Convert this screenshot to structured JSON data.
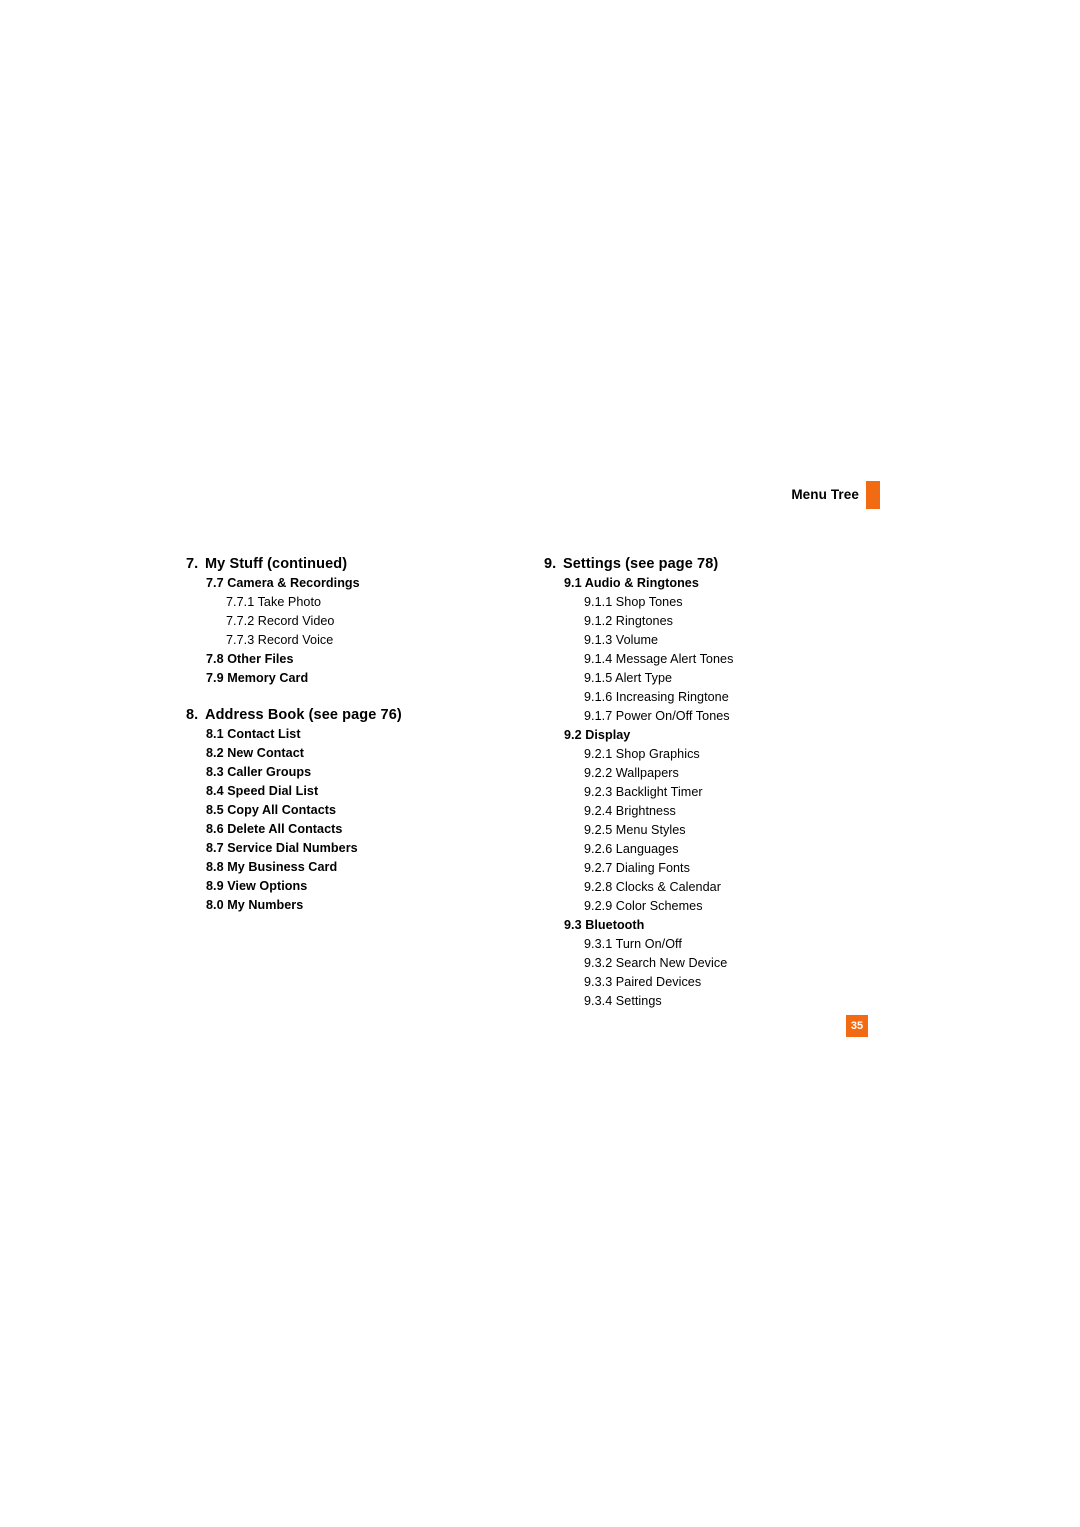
{
  "header": {
    "title": "Menu Tree",
    "accent_color": "#f26a12"
  },
  "folio": {
    "page_number": "35",
    "background_color": "#f26a12",
    "text_color": "#ffffff"
  },
  "columns": {
    "left": [
      {
        "number": "7.",
        "title": "My Stuff (continued)",
        "gap_before": false,
        "items": [
          {
            "level": 2,
            "label": "7.7 Camera & Recordings"
          },
          {
            "level": 3,
            "label": "7.7.1 Take Photo"
          },
          {
            "level": 3,
            "label": "7.7.2 Record Video"
          },
          {
            "level": 3,
            "label": "7.7.3 Record Voice"
          },
          {
            "level": 2,
            "label": "7.8 Other Files"
          },
          {
            "level": 2,
            "label": "7.9 Memory Card"
          }
        ]
      },
      {
        "number": "8.",
        "title": "Address Book (see page 76)",
        "gap_before": true,
        "items": [
          {
            "level": 2,
            "label": "8.1 Contact List"
          },
          {
            "level": 2,
            "label": "8.2 New Contact"
          },
          {
            "level": 2,
            "label": "8.3 Caller Groups"
          },
          {
            "level": 2,
            "label": "8.4 Speed Dial List"
          },
          {
            "level": 2,
            "label": "8.5 Copy All Contacts"
          },
          {
            "level": 2,
            "label": "8.6 Delete All Contacts"
          },
          {
            "level": 2,
            "label": "8.7 Service Dial Numbers"
          },
          {
            "level": 2,
            "label": "8.8 My Business Card"
          },
          {
            "level": 2,
            "label": "8.9 View Options"
          },
          {
            "level": 2,
            "label": "8.0 My Numbers"
          }
        ]
      }
    ],
    "right": [
      {
        "number": "9.",
        "title": "Settings (see page 78)",
        "gap_before": false,
        "items": [
          {
            "level": 2,
            "label": "9.1 Audio & Ringtones"
          },
          {
            "level": 3,
            "label": "9.1.1 Shop Tones"
          },
          {
            "level": 3,
            "label": "9.1.2 Ringtones"
          },
          {
            "level": 3,
            "label": "9.1.3 Volume"
          },
          {
            "level": 3,
            "label": "9.1.4 Message Alert Tones"
          },
          {
            "level": 3,
            "label": "9.1.5 Alert Type"
          },
          {
            "level": 3,
            "label": "9.1.6 Increasing Ringtone"
          },
          {
            "level": 3,
            "label": "9.1.7 Power On/Off Tones"
          },
          {
            "level": 2,
            "label": "9.2 Display"
          },
          {
            "level": 3,
            "label": "9.2.1 Shop Graphics"
          },
          {
            "level": 3,
            "label": "9.2.2 Wallpapers"
          },
          {
            "level": 3,
            "label": "9.2.3 Backlight Timer"
          },
          {
            "level": 3,
            "label": "9.2.4 Brightness"
          },
          {
            "level": 3,
            "label": "9.2.5 Menu Styles"
          },
          {
            "level": 3,
            "label": "9.2.6 Languages"
          },
          {
            "level": 3,
            "label": "9.2.7 Dialing Fonts"
          },
          {
            "level": 3,
            "label": "9.2.8 Clocks & Calendar"
          },
          {
            "level": 3,
            "label": "9.2.9 Color Schemes"
          },
          {
            "level": 2,
            "label": "9.3 Bluetooth"
          },
          {
            "level": 3,
            "label": "9.3.1 Turn On/Off"
          },
          {
            "level": 3,
            "label": "9.3.2 Search New Device"
          },
          {
            "level": 3,
            "label": "9.3.3 Paired Devices"
          },
          {
            "level": 3,
            "label": "9.3.4 Settings"
          }
        ]
      }
    ]
  }
}
